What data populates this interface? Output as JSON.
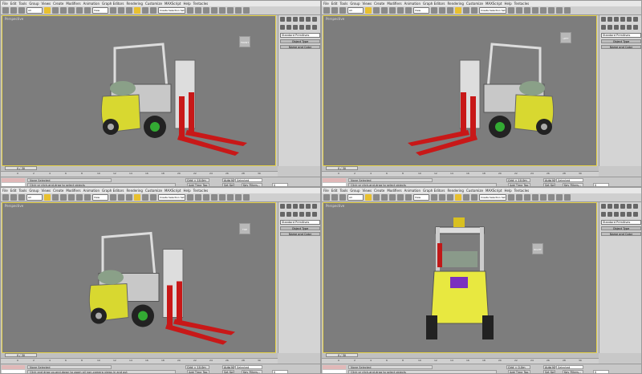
{
  "menu": [
    "File",
    "Edit",
    "Tools",
    "Group",
    "Views",
    "Create",
    "Modifiers",
    "Animation",
    "Graph Editors",
    "Rendering",
    "Customize",
    "MAXScript",
    "Help",
    "Tentacles"
  ],
  "toolbar": {
    "selection_filter": "All",
    "ref_coord": "View",
    "named_selection": "Create Selection Set"
  },
  "command_panel": {
    "dropdown": "Standard Primitives",
    "rollouts": [
      "Object Type",
      "Name and Color"
    ]
  },
  "time_slider": "0 / 30",
  "ruler_ticks": [
    "0",
    "2",
    "4",
    "6",
    "8",
    "10",
    "12",
    "14",
    "16",
    "18",
    "20",
    "22",
    "24",
    "26",
    "28",
    "30"
  ],
  "status": {
    "selection": "None Selected",
    "auto_key": "Auto Key",
    "set_key": "Set Key",
    "key_mode": "Selected",
    "key_filters": "Key Filters...",
    "add_time_tag": "Add Time Tag",
    "frame": "0"
  },
  "panels": [
    {
      "viewport_label": "Perspective",
      "prompt": "Click or click-and-drag to select objects",
      "grid": "Grid = 10.0m",
      "cube_label": "FRONT"
    },
    {
      "viewport_label": "Perspective",
      "prompt": "Click or click-and-drag to select objects",
      "grid": "Grid = 10.0m",
      "cube_label": "LEFT"
    },
    {
      "viewport_label": "Perspective",
      "prompt": "Click and drag up-and-down to zoom all non-camera views in and out",
      "grid": "Grid = 10.0m",
      "cube_label": "TOP"
    },
    {
      "viewport_label": "Perspective",
      "prompt": "Click or click-and-drag to select objects",
      "grid": "Grid = 0.0m",
      "cube_label": "RIGHT"
    }
  ]
}
